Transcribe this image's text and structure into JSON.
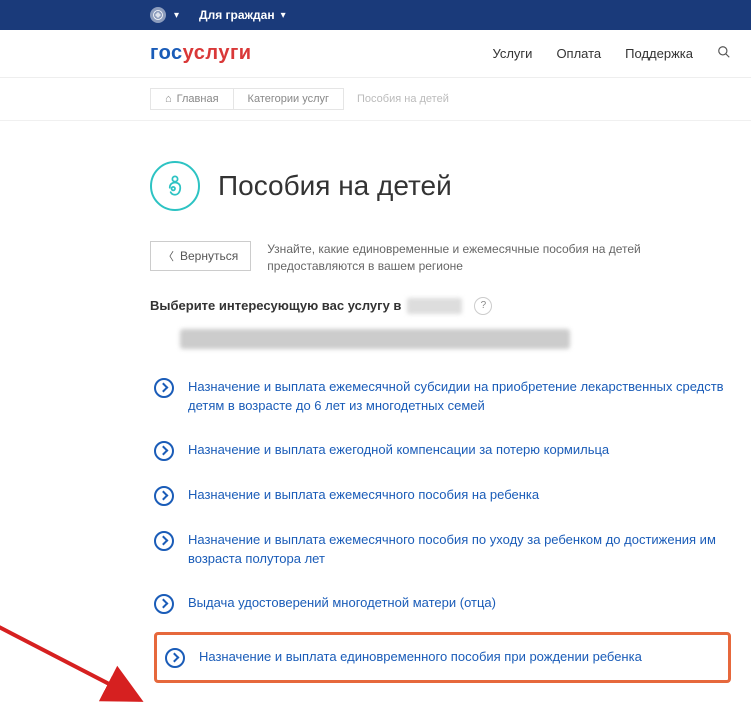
{
  "topbar": {
    "audience_label": "Для граждан"
  },
  "logo": {
    "part1": "гос",
    "part2": "услуги"
  },
  "nav": {
    "services": "Услуги",
    "payment": "Оплата",
    "support": "Поддержка"
  },
  "breadcrumbs": {
    "home": "Главная",
    "cat": "Категории услуг",
    "current": "Пособия на детей"
  },
  "page": {
    "title": "Пособия на детей",
    "back": "Вернуться",
    "intro": "Узнайте, какие единовременные и ежемесячные пособия на детей предоставляются в вашем регионе",
    "select_prefix": "Выберите интересующую вас услугу в",
    "help": "?"
  },
  "services": [
    {
      "label": "Назначение и выплата ежемесячной субсидии на приобретение лекарственных средств детям в возрасте до 6 лет из многодетных семей"
    },
    {
      "label": "Назначение и выплата ежегодной компенсации за потерю кормильца"
    },
    {
      "label": "Назначение и выплата ежемесячного пособия на ребенка"
    },
    {
      "label": "Назначение и выплата ежемесячного пособия по уходу за ребенком до достижения им возраста полутора лет"
    },
    {
      "label": "Выдача удостоверений многодетной матери (отца)"
    },
    {
      "label": "Назначение и выплата единовременного пособия при рождении ребенка"
    }
  ]
}
